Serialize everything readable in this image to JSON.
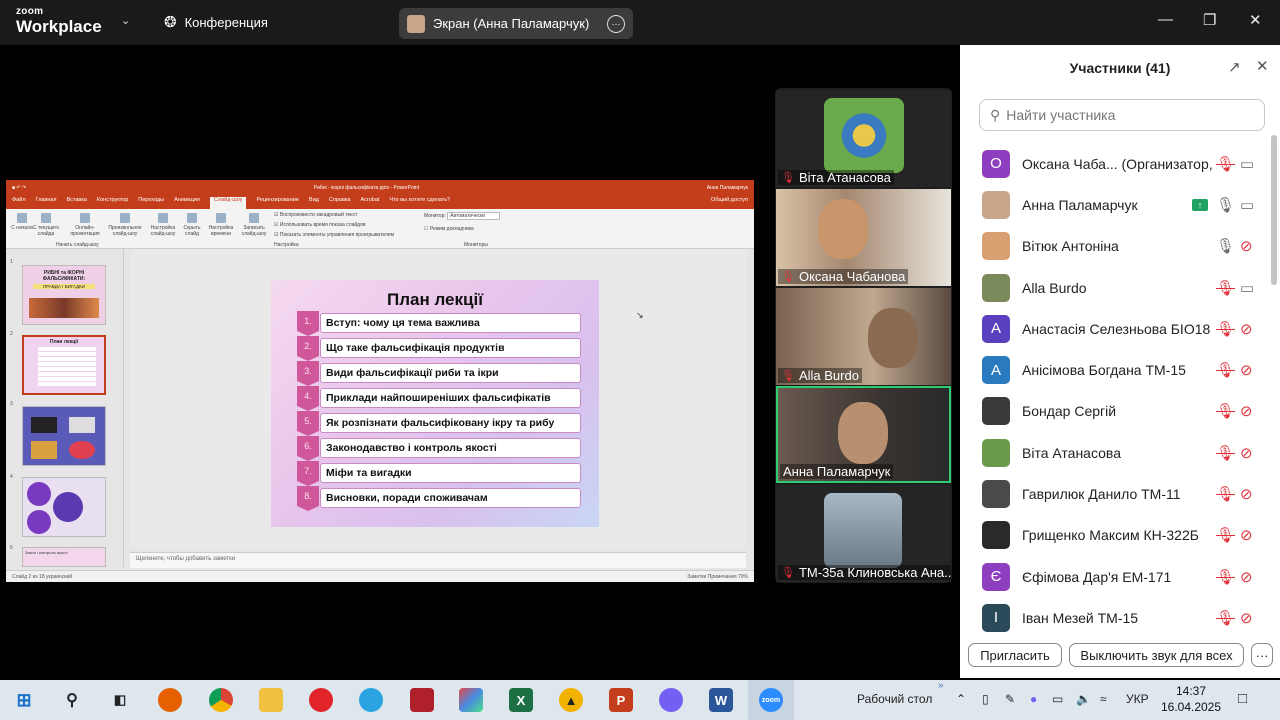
{
  "app": {
    "brand_line1": "zoom",
    "brand_line2": "Workplace",
    "menu_label": "Конференция"
  },
  "share_pill": {
    "label": "Экран (Анна Паламарчук)",
    "more_glyph": "···"
  },
  "window_controls": {
    "minimize": "—",
    "restore": "❐",
    "close": "✕"
  },
  "ppt": {
    "title_bar": "Рибні - ікорні фальсифікати.pptx - PowerPoint",
    "user": "Анна Паламарчук",
    "share": "Общий доступ",
    "tabs": [
      "Файл",
      "Главная",
      "Вставка",
      "Конструктор",
      "Переходы",
      "Анимация",
      "Слайд-шоу",
      "Рецензирование",
      "Вид",
      "Справка",
      "Acrobat",
      "Что вы хотите сделать?"
    ],
    "active_tab": "Слайд-шоу",
    "ribbon": {
      "buttons": [
        "С начала",
        "С текущего слайда",
        "Онлайн-презентация",
        "Произвольное слайд-шоу",
        "Настройка слайд-шоу",
        "Скрыть слайд",
        "Настройка времени",
        "Записать слайд-шоу"
      ],
      "checks": [
        "Воспроизвести закадровый текст",
        "Использовать время показа слайдов",
        "Показать элементы управления проигрывателем"
      ],
      "monitor_label": "Монитор:",
      "monitor_value": "Автоматически",
      "presenter_mode": "Режим докладчика",
      "group_start": "Начать слайд-шоу",
      "group_setup": "Настройка",
      "group_monitors": "Мониторы"
    },
    "thumb_numbers": [
      "1",
      "2",
      "3",
      "4",
      "5"
    ],
    "thumb1": {
      "title": "РИБНІ та ІКОРНІ ФАЛЬСИФІКАТИ:",
      "sub": "ПРАВДА І ВИГАДКИ"
    },
    "thumb5": "Закон і контроль якості",
    "notes_placeholder": "Щелкните, чтобы добавить заметки",
    "status_left": "Слайд 2 из 18    украинский",
    "status_right": "Заметки   Примечания   70%",
    "slide": {
      "title": "План лекції",
      "items": [
        {
          "n": "1.",
          "text": "Вступ: чому ця тема важлива"
        },
        {
          "n": "2.",
          "text": "Що таке фальсифікація продуктів"
        },
        {
          "n": "3.",
          "text": "Види фальсифікації риби та ікри"
        },
        {
          "n": "4.",
          "text": "Приклади найпоширеніших фальсифікатів"
        },
        {
          "n": "5.",
          "text": "Як розпізнати фальсифіковану ікру та рибу"
        },
        {
          "n": "6.",
          "text": "Законодавство і контроль якості"
        },
        {
          "n": "7.",
          "text": "Міфи та вигадки"
        },
        {
          "n": "8.",
          "text": "Висновки, поради споживачам"
        }
      ]
    }
  },
  "videos": [
    {
      "name": "Віта Атанасова",
      "muted": true,
      "bg": "#6b9a4a"
    },
    {
      "name": "Оксана Чабанова",
      "muted": true,
      "bg": "#8a7a68"
    },
    {
      "name": "Alla Burdo",
      "muted": true,
      "bg": "#6e5a48"
    },
    {
      "name": "Анна Паламарчук",
      "muted": false,
      "bg": "#4a4440",
      "active": true
    },
    {
      "name": "ТМ-35а Клиновська Ана...",
      "muted": true,
      "bg": "#8aa0b0"
    }
  ],
  "panel": {
    "title": "Участники (41)",
    "search_placeholder": "Найти участника",
    "participants": [
      {
        "name": "Оксана Чаба... (Организатор, я)",
        "initial": "О",
        "color": "#8e3fbf",
        "mic": "muted",
        "video": "on"
      },
      {
        "name": "Анна Паламарчук",
        "initial": "",
        "color": "#c9a58a",
        "mic": "on",
        "video": "on",
        "sharing": true
      },
      {
        "name": "Вітюк Антоніна",
        "initial": "",
        "color": "#d8a070",
        "mic": "on",
        "video": "off"
      },
      {
        "name": "Alla Burdo",
        "initial": "",
        "color": "#7a8a5a",
        "mic": "muted",
        "video": "on"
      },
      {
        "name": "Анастасія Селезньова БІО18",
        "initial": "А",
        "color": "#5a3fbf",
        "mic": "muted",
        "video": "off"
      },
      {
        "name": "Анісімова Богдана ТМ-15",
        "initial": "А",
        "color": "#2a7ac0",
        "mic": "muted",
        "video": "off"
      },
      {
        "name": "Бондар Сергій",
        "initial": "",
        "color": "#3a3a3a",
        "mic": "muted",
        "video": "off"
      },
      {
        "name": "Віта Атанасова",
        "initial": "",
        "color": "#6b9a4a",
        "mic": "muted",
        "video": "off"
      },
      {
        "name": "Гаврилюк Данило ТМ-11",
        "initial": "",
        "color": "#4a4a4a",
        "mic": "muted",
        "video": "off"
      },
      {
        "name": "Грищенко Максим КН-322Б",
        "initial": "",
        "color": "#2a2a2a",
        "mic": "muted",
        "video": "off"
      },
      {
        "name": "Єфімова Дар'я ЕМ-171",
        "initial": "Є",
        "color": "#8e3fbf",
        "mic": "muted",
        "video": "off"
      },
      {
        "name": "Іван Мезей ТМ-15",
        "initial": "І",
        "color": "#2a4a5a",
        "mic": "muted",
        "video": "off"
      }
    ],
    "invite": "Пригласить",
    "mute_all": "Выключить звук для всех",
    "more": "···"
  },
  "taskbar": {
    "desktop_label": "Рабочий стол",
    "lang": "УКР",
    "time": "14:37",
    "date": "16.04.2025"
  }
}
